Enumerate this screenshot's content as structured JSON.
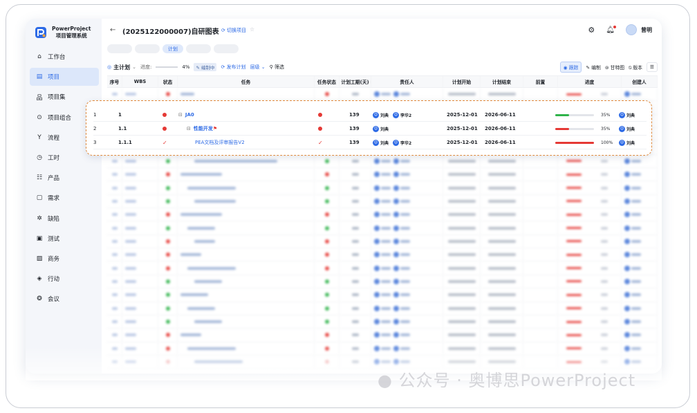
{
  "app": {
    "logo_line1": "PowerProject",
    "logo_line2": "项目管理系统",
    "title": "(2025122000007)自研图表",
    "switch_label": "切换项目",
    "user_name": "曾明"
  },
  "sidebar": {
    "items": [
      {
        "label": "工作台",
        "icon": "home-icon",
        "glyph": "⌂"
      },
      {
        "label": "项目",
        "icon": "project-icon",
        "glyph": "▤"
      },
      {
        "label": "项目集",
        "icon": "program-icon",
        "glyph": "品"
      },
      {
        "label": "项目组合",
        "icon": "portfolio-icon",
        "glyph": "⊙"
      },
      {
        "label": "流程",
        "icon": "flow-icon",
        "glyph": "Y"
      },
      {
        "label": "工时",
        "icon": "clock-icon",
        "glyph": "◷"
      },
      {
        "label": "产品",
        "icon": "product-icon",
        "glyph": "☷"
      },
      {
        "label": "需求",
        "icon": "requirement-icon",
        "glyph": "▢"
      },
      {
        "label": "缺陷",
        "icon": "bug-icon",
        "glyph": "✲"
      },
      {
        "label": "测试",
        "icon": "test-icon",
        "glyph": "▣"
      },
      {
        "label": "商务",
        "icon": "business-icon",
        "glyph": "▨"
      },
      {
        "label": "行动",
        "icon": "action-icon",
        "glyph": "◈"
      },
      {
        "label": "会议",
        "icon": "meeting-icon",
        "glyph": "❂"
      }
    ]
  },
  "tabs": {
    "active": "计划"
  },
  "toolbar": {
    "plan_label": "主计划",
    "progress_label": "进度:",
    "progress_value": "4%",
    "edit_badge": "编制中",
    "publish_label": "发布计划",
    "level_label": "层级",
    "filter_label": "筛选",
    "track_label": "跟踪",
    "edit_label": "编制",
    "gantt_label": "甘特图",
    "version_label": "版本"
  },
  "table": {
    "headers": [
      "序号",
      "WBS",
      "状态",
      "任务",
      "任务状态",
      "计划工期(天)",
      "责任人",
      "计划开始",
      "计划结束",
      "前置",
      "进度",
      "创建人"
    ]
  },
  "highlighted_rows": [
    {
      "no": "1",
      "wbs": "1",
      "status": "dot",
      "task": "JA0",
      "expand": "⊟",
      "indent": 0,
      "flag": false,
      "task_status": "dot",
      "duration": "139",
      "owners": [
        "刘典",
        "李华2"
      ],
      "start": "2025-12-01",
      "end": "2026-06-11",
      "progress": 35,
      "progress_text": "35%",
      "progress_color": "#2fb34a",
      "creator": "刘典"
    },
    {
      "no": "2",
      "wbs": "1.1",
      "status": "dot",
      "task": "性能开发",
      "expand": "⊟",
      "indent": 1,
      "flag": true,
      "task_status": "dot",
      "duration": "139",
      "owners": [
        "刘典"
      ],
      "start": "2025-12-01",
      "end": "2026-06-11",
      "progress": 35,
      "progress_text": "35%",
      "progress_color": "#e53935",
      "creator": "刘典"
    },
    {
      "no": "3",
      "wbs": "1.1.1",
      "status": "check",
      "task": "PEA文档及评审报告V2",
      "expand": "",
      "indent": 2,
      "flag": false,
      "task_status": "check",
      "duration": "139",
      "owners": [
        "刘典",
        "李华2"
      ],
      "start": "2025-12-01",
      "end": "2026-06-11",
      "progress": 100,
      "progress_text": "100%",
      "progress_color": "#e53935",
      "creator": "刘典"
    }
  ],
  "watermark": "公众号 · 奥博思PowerProject"
}
